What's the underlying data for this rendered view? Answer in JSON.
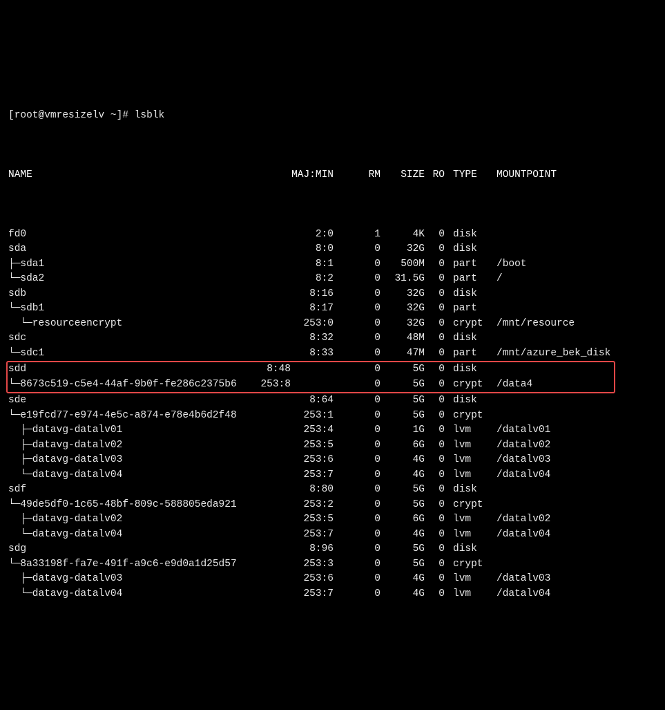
{
  "prompt_line": "[root@vmresizelv ~]# lsblk",
  "headers": {
    "name": "NAME",
    "majmin": "MAJ:MIN",
    "rm": "RM",
    "size": "SIZE",
    "ro": "RO",
    "type": "TYPE",
    "mountpoint": "MOUNTPOINT"
  },
  "rows": [
    {
      "name": "fd0",
      "maj": "2:0",
      "rm": "1",
      "size": "4K",
      "ro": "0",
      "type": "disk",
      "mp": "",
      "hi": false
    },
    {
      "name": "sda",
      "maj": "8:0",
      "rm": "0",
      "size": "32G",
      "ro": "0",
      "type": "disk",
      "mp": "",
      "hi": false
    },
    {
      "name": "├─sda1",
      "maj": "8:1",
      "rm": "0",
      "size": "500M",
      "ro": "0",
      "type": "part",
      "mp": "/boot",
      "hi": false
    },
    {
      "name": "└─sda2",
      "maj": "8:2",
      "rm": "0",
      "size": "31.5G",
      "ro": "0",
      "type": "part",
      "mp": "/",
      "hi": false
    },
    {
      "name": "sdb",
      "maj": "8:16",
      "rm": "0",
      "size": "32G",
      "ro": "0",
      "type": "disk",
      "mp": "",
      "hi": false
    },
    {
      "name": "└─sdb1",
      "maj": "8:17",
      "rm": "0",
      "size": "32G",
      "ro": "0",
      "type": "part",
      "mp": "",
      "hi": false
    },
    {
      "name": "  └─resourceencrypt",
      "maj": "253:0",
      "rm": "0",
      "size": "32G",
      "ro": "0",
      "type": "crypt",
      "mp": "/mnt/resource",
      "hi": false
    },
    {
      "name": "sdc",
      "maj": "8:32",
      "rm": "0",
      "size": "48M",
      "ro": "0",
      "type": "disk",
      "mp": "",
      "hi": false
    },
    {
      "name": "└─sdc1",
      "maj": "8:33",
      "rm": "0",
      "size": "47M",
      "ro": "0",
      "type": "part",
      "mp": "/mnt/azure_bek_disk",
      "hi": false
    },
    {
      "name": "sdd",
      "maj": "8:48",
      "rm": "0",
      "size": "5G",
      "ro": "0",
      "type": "disk",
      "mp": "",
      "hi": true
    },
    {
      "name": "└─8673c519-c5e4-44af-9b0f-fe286c2375b6",
      "maj": "253:8",
      "rm": "0",
      "size": "5G",
      "ro": "0",
      "type": "crypt",
      "mp": "/data4",
      "hi": true
    },
    {
      "name": "sde",
      "maj": "8:64",
      "rm": "0",
      "size": "5G",
      "ro": "0",
      "type": "disk",
      "mp": "",
      "hi": false
    },
    {
      "name": "└─e19fcd77-e974-4e5c-a874-e78e4b6d2f48",
      "maj": "253:1",
      "rm": "0",
      "size": "5G",
      "ro": "0",
      "type": "crypt",
      "mp": "",
      "hi": false
    },
    {
      "name": "  ├─datavg-datalv01",
      "maj": "253:4",
      "rm": "0",
      "size": "1G",
      "ro": "0",
      "type": "lvm",
      "mp": "/datalv01",
      "hi": false
    },
    {
      "name": "  ├─datavg-datalv02",
      "maj": "253:5",
      "rm": "0",
      "size": "6G",
      "ro": "0",
      "type": "lvm",
      "mp": "/datalv02",
      "hi": false
    },
    {
      "name": "  ├─datavg-datalv03",
      "maj": "253:6",
      "rm": "0",
      "size": "4G",
      "ro": "0",
      "type": "lvm",
      "mp": "/datalv03",
      "hi": false
    },
    {
      "name": "  └─datavg-datalv04",
      "maj": "253:7",
      "rm": "0",
      "size": "4G",
      "ro": "0",
      "type": "lvm",
      "mp": "/datalv04",
      "hi": false
    },
    {
      "name": "sdf",
      "maj": "8:80",
      "rm": "0",
      "size": "5G",
      "ro": "0",
      "type": "disk",
      "mp": "",
      "hi": false
    },
    {
      "name": "└─49de5df0-1c65-48bf-809c-588805eda921",
      "maj": "253:2",
      "rm": "0",
      "size": "5G",
      "ro": "0",
      "type": "crypt",
      "mp": "",
      "hi": false
    },
    {
      "name": "  ├─datavg-datalv02",
      "maj": "253:5",
      "rm": "0",
      "size": "6G",
      "ro": "0",
      "type": "lvm",
      "mp": "/datalv02",
      "hi": false
    },
    {
      "name": "  └─datavg-datalv04",
      "maj": "253:7",
      "rm": "0",
      "size": "4G",
      "ro": "0",
      "type": "lvm",
      "mp": "/datalv04",
      "hi": false
    },
    {
      "name": "sdg",
      "maj": "8:96",
      "rm": "0",
      "size": "5G",
      "ro": "0",
      "type": "disk",
      "mp": "",
      "hi": false
    },
    {
      "name": "└─8a33198f-fa7e-491f-a9c6-e9d0a1d25d57",
      "maj": "253:3",
      "rm": "0",
      "size": "5G",
      "ro": "0",
      "type": "crypt",
      "mp": "",
      "hi": false
    },
    {
      "name": "  ├─datavg-datalv03",
      "maj": "253:6",
      "rm": "0",
      "size": "4G",
      "ro": "0",
      "type": "lvm",
      "mp": "/datalv03",
      "hi": false
    },
    {
      "name": "  └─datavg-datalv04",
      "maj": "253:7",
      "rm": "0",
      "size": "4G",
      "ro": "0",
      "type": "lvm",
      "mp": "/datalv04",
      "hi": false
    }
  ]
}
